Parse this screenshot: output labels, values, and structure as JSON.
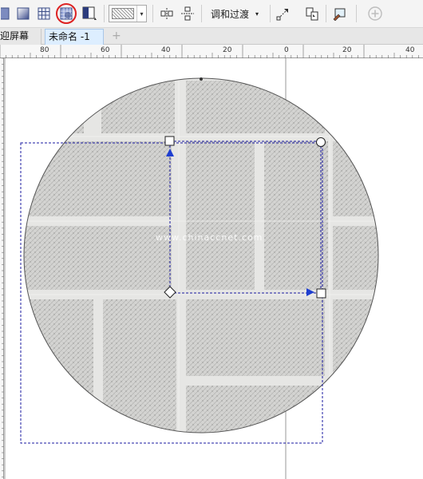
{
  "toolbar": {
    "tools": [
      {
        "name": "fill-tool",
        "icon": "flat-square-icon"
      },
      {
        "name": "gradient-tool",
        "icon": "gradient-square-icon"
      },
      {
        "name": "mesh-tool",
        "icon": "grid-icon"
      },
      {
        "name": "transparency-tool",
        "icon": "transparency-icon",
        "highlighted": true
      },
      {
        "name": "shape-edit-tool",
        "icon": "half-filled-square-icon"
      }
    ],
    "blend_label": "调和过渡",
    "dropdown_arrow": "▾",
    "add_icon": "add-circle-icon"
  },
  "tabs": {
    "welcome": "迎屏幕",
    "document": "未命名 -1",
    "add": "+"
  },
  "ruler": {
    "labels": [
      "80",
      "60",
      "40",
      "20",
      "0",
      "20",
      "40"
    ]
  },
  "canvas": {
    "watermark": "www.chinaccnet.com",
    "colors": {
      "selection": "#1a1aa0",
      "handle_fill": "#ffffff",
      "accent_blue": "#1f3fd0",
      "tile": "#d3d3d1",
      "grout": "#e9e9e7"
    }
  }
}
